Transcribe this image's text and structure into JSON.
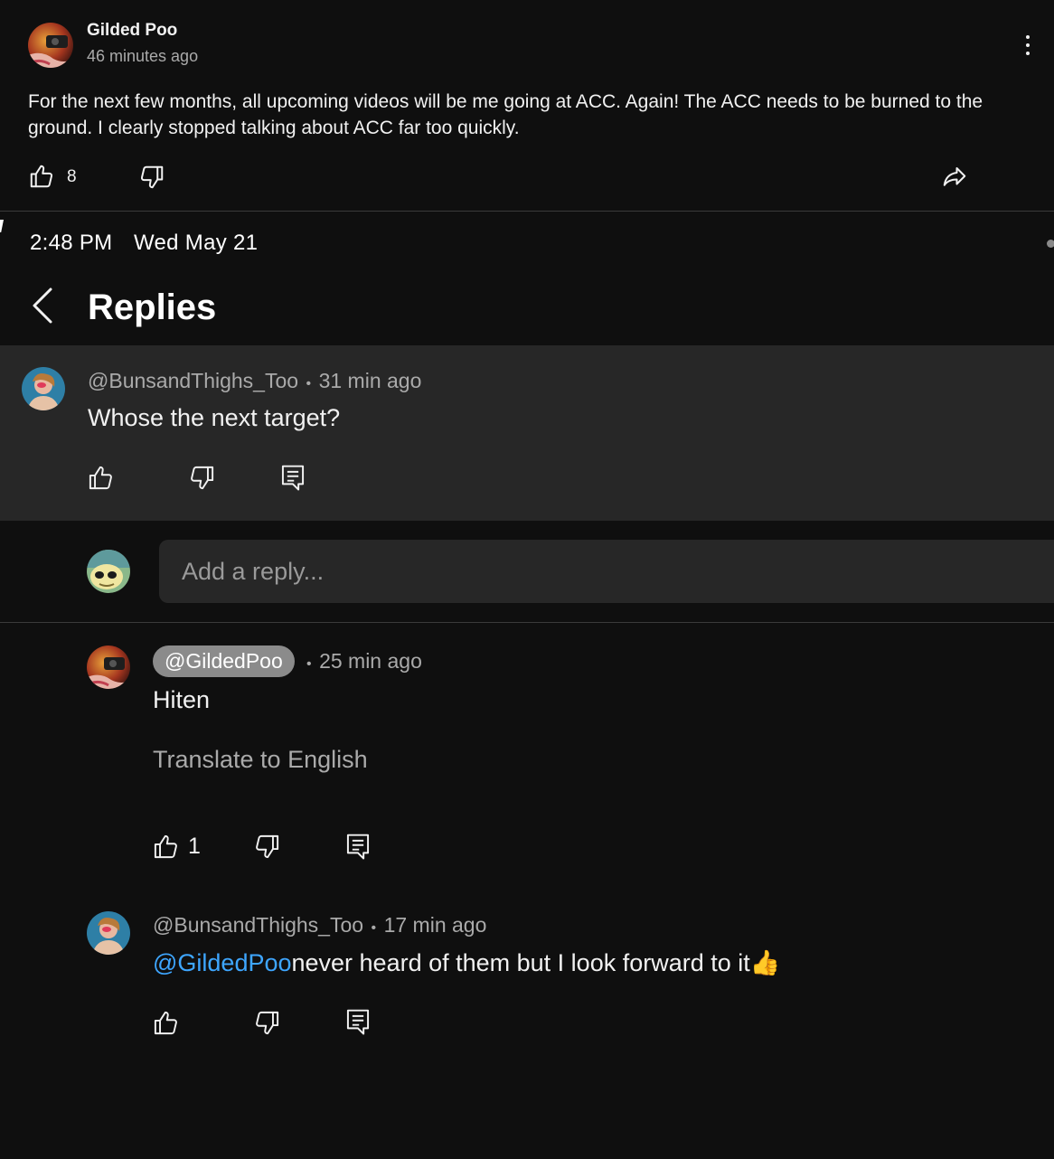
{
  "post": {
    "author": "Gilded Poo",
    "time": "46 minutes ago",
    "body": "For the next few months, all upcoming videos will be me going at ACC. Again! The ACC needs to be burned to the ground. I clearly stopped talking about ACC far too quickly.",
    "like_count": "8",
    "icons": [
      "avatar",
      "more-vert-icon",
      "thumb-up-icon",
      "thumb-down-icon",
      "share-icon"
    ]
  },
  "status_bar": {
    "time": "2:48 PM",
    "date": "Wed May 21"
  },
  "header": {
    "title": "Replies",
    "back_icon": "chevron-left-icon"
  },
  "parent_comment": {
    "handle": "@BunsandThighs_Too",
    "separator": "•",
    "time": "31 min ago",
    "text": "Whose the next target?"
  },
  "reply_input": {
    "placeholder": "Add a reply..."
  },
  "replies": [
    {
      "handle": "@GildedPoo",
      "separator": "•",
      "time": "25 min ago",
      "text": "Hiten",
      "translate_label": "Translate to English",
      "like_count": "1"
    },
    {
      "handle": "@BunsandThighs_Too",
      "separator": "•",
      "time": "17 min ago",
      "mention": "@GildedPoo",
      "text": "never heard of them but I look forward to it",
      "emoji": "👍"
    }
  ],
  "colors": {
    "background": "#0f0f0f",
    "panel": "#272727",
    "text": "#f1f1f1",
    "muted": "#aaaaaa",
    "mention": "#3ea6ff",
    "chip": "#8b8b8b"
  }
}
